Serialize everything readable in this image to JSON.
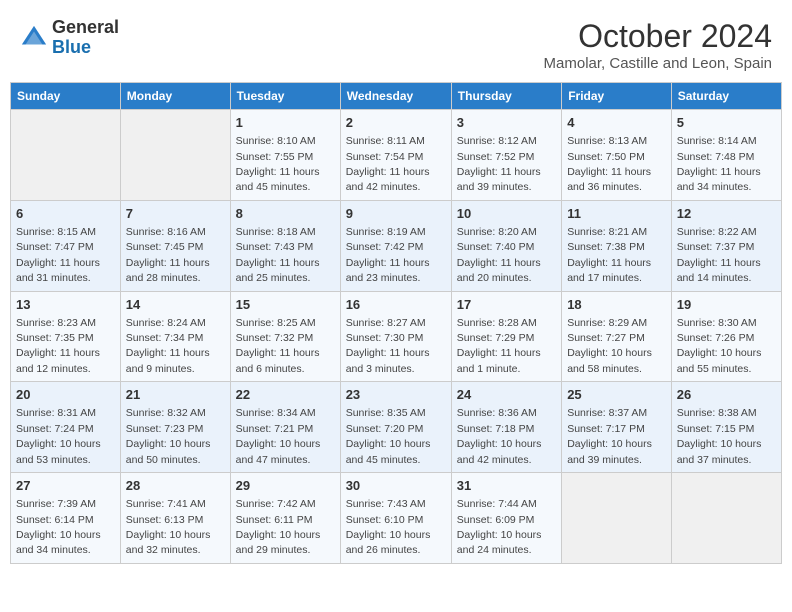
{
  "header": {
    "logo_general": "General",
    "logo_blue": "Blue",
    "month": "October 2024",
    "location": "Mamolar, Castille and Leon, Spain"
  },
  "weekdays": [
    "Sunday",
    "Monday",
    "Tuesday",
    "Wednesday",
    "Thursday",
    "Friday",
    "Saturday"
  ],
  "weeks": [
    [
      null,
      null,
      {
        "day": "1",
        "sunrise": "8:10 AM",
        "sunset": "7:55 PM",
        "daylight": "11 hours and 45 minutes."
      },
      {
        "day": "2",
        "sunrise": "8:11 AM",
        "sunset": "7:54 PM",
        "daylight": "11 hours and 42 minutes."
      },
      {
        "day": "3",
        "sunrise": "8:12 AM",
        "sunset": "7:52 PM",
        "daylight": "11 hours and 39 minutes."
      },
      {
        "day": "4",
        "sunrise": "8:13 AM",
        "sunset": "7:50 PM",
        "daylight": "11 hours and 36 minutes."
      },
      {
        "day": "5",
        "sunrise": "8:14 AM",
        "sunset": "7:48 PM",
        "daylight": "11 hours and 34 minutes."
      }
    ],
    [
      {
        "day": "6",
        "sunrise": "8:15 AM",
        "sunset": "7:47 PM",
        "daylight": "11 hours and 31 minutes."
      },
      {
        "day": "7",
        "sunrise": "8:16 AM",
        "sunset": "7:45 PM",
        "daylight": "11 hours and 28 minutes."
      },
      {
        "day": "8",
        "sunrise": "8:18 AM",
        "sunset": "7:43 PM",
        "daylight": "11 hours and 25 minutes."
      },
      {
        "day": "9",
        "sunrise": "8:19 AM",
        "sunset": "7:42 PM",
        "daylight": "11 hours and 23 minutes."
      },
      {
        "day": "10",
        "sunrise": "8:20 AM",
        "sunset": "7:40 PM",
        "daylight": "11 hours and 20 minutes."
      },
      {
        "day": "11",
        "sunrise": "8:21 AM",
        "sunset": "7:38 PM",
        "daylight": "11 hours and 17 minutes."
      },
      {
        "day": "12",
        "sunrise": "8:22 AM",
        "sunset": "7:37 PM",
        "daylight": "11 hours and 14 minutes."
      }
    ],
    [
      {
        "day": "13",
        "sunrise": "8:23 AM",
        "sunset": "7:35 PM",
        "daylight": "11 hours and 12 minutes."
      },
      {
        "day": "14",
        "sunrise": "8:24 AM",
        "sunset": "7:34 PM",
        "daylight": "11 hours and 9 minutes."
      },
      {
        "day": "15",
        "sunrise": "8:25 AM",
        "sunset": "7:32 PM",
        "daylight": "11 hours and 6 minutes."
      },
      {
        "day": "16",
        "sunrise": "8:27 AM",
        "sunset": "7:30 PM",
        "daylight": "11 hours and 3 minutes."
      },
      {
        "day": "17",
        "sunrise": "8:28 AM",
        "sunset": "7:29 PM",
        "daylight": "11 hours and 1 minute."
      },
      {
        "day": "18",
        "sunrise": "8:29 AM",
        "sunset": "7:27 PM",
        "daylight": "10 hours and 58 minutes."
      },
      {
        "day": "19",
        "sunrise": "8:30 AM",
        "sunset": "7:26 PM",
        "daylight": "10 hours and 55 minutes."
      }
    ],
    [
      {
        "day": "20",
        "sunrise": "8:31 AM",
        "sunset": "7:24 PM",
        "daylight": "10 hours and 53 minutes."
      },
      {
        "day": "21",
        "sunrise": "8:32 AM",
        "sunset": "7:23 PM",
        "daylight": "10 hours and 50 minutes."
      },
      {
        "day": "22",
        "sunrise": "8:34 AM",
        "sunset": "7:21 PM",
        "daylight": "10 hours and 47 minutes."
      },
      {
        "day": "23",
        "sunrise": "8:35 AM",
        "sunset": "7:20 PM",
        "daylight": "10 hours and 45 minutes."
      },
      {
        "day": "24",
        "sunrise": "8:36 AM",
        "sunset": "7:18 PM",
        "daylight": "10 hours and 42 minutes."
      },
      {
        "day": "25",
        "sunrise": "8:37 AM",
        "sunset": "7:17 PM",
        "daylight": "10 hours and 39 minutes."
      },
      {
        "day": "26",
        "sunrise": "8:38 AM",
        "sunset": "7:15 PM",
        "daylight": "10 hours and 37 minutes."
      }
    ],
    [
      {
        "day": "27",
        "sunrise": "7:39 AM",
        "sunset": "6:14 PM",
        "daylight": "10 hours and 34 minutes."
      },
      {
        "day": "28",
        "sunrise": "7:41 AM",
        "sunset": "6:13 PM",
        "daylight": "10 hours and 32 minutes."
      },
      {
        "day": "29",
        "sunrise": "7:42 AM",
        "sunset": "6:11 PM",
        "daylight": "10 hours and 29 minutes."
      },
      {
        "day": "30",
        "sunrise": "7:43 AM",
        "sunset": "6:10 PM",
        "daylight": "10 hours and 26 minutes."
      },
      {
        "day": "31",
        "sunrise": "7:44 AM",
        "sunset": "6:09 PM",
        "daylight": "10 hours and 24 minutes."
      },
      null,
      null
    ]
  ],
  "labels": {
    "sunrise": "Sunrise:",
    "sunset": "Sunset:",
    "daylight": "Daylight:"
  }
}
